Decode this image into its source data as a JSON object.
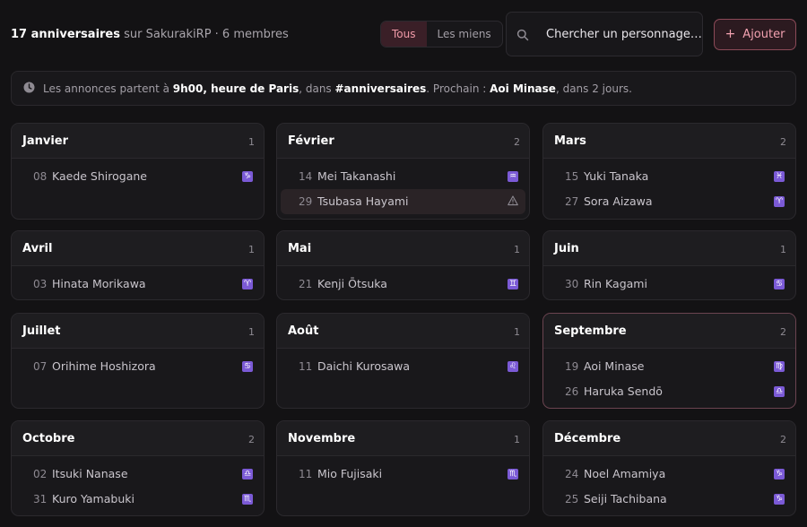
{
  "header": {
    "count": "17 anniversaires",
    "rest": " sur SakurakiRP · 6 membres"
  },
  "filters": {
    "all": "Tous",
    "mine": "Les miens",
    "active": "Tous"
  },
  "search": {
    "placeholder": "Chercher un personnage…"
  },
  "add_button": {
    "label": "Ajouter"
  },
  "notice": {
    "t1": "Les annonces partent à ",
    "b1": "9h00, heure de Paris",
    "t2": ", dans ",
    "b2": "#anniversaires",
    "t3": ". Prochain : ",
    "b3": "Aoi Minase",
    "t4": ", dans 2 jours."
  },
  "months": [
    {
      "name": "Janvier",
      "count": "1",
      "people": [
        {
          "day": "08",
          "name": "Kaede Shirogane",
          "sign": "♑"
        }
      ]
    },
    {
      "name": "Février",
      "count": "2",
      "people": [
        {
          "day": "14",
          "name": "Mei Takanashi",
          "sign": "♒"
        },
        {
          "day": "29",
          "name": "Tsubasa Hayami",
          "sign": "warning",
          "selected": true
        }
      ]
    },
    {
      "name": "Mars",
      "count": "2",
      "people": [
        {
          "day": "15",
          "name": "Yuki Tanaka",
          "sign": "♓"
        },
        {
          "day": "27",
          "name": "Sora Aizawa",
          "sign": "♈"
        }
      ]
    },
    {
      "name": "Avril",
      "count": "1",
      "people": [
        {
          "day": "03",
          "name": "Hinata Morikawa",
          "sign": "♈"
        }
      ]
    },
    {
      "name": "Mai",
      "count": "1",
      "people": [
        {
          "day": "21",
          "name": "Kenji Ōtsuka",
          "sign": "♊"
        }
      ]
    },
    {
      "name": "Juin",
      "count": "1",
      "people": [
        {
          "day": "30",
          "name": "Rin Kagami",
          "sign": "♋"
        }
      ]
    },
    {
      "name": "Juillet",
      "count": "1",
      "people": [
        {
          "day": "07",
          "name": "Orihime Hoshizora",
          "sign": "♋"
        }
      ]
    },
    {
      "name": "Août",
      "count": "1",
      "people": [
        {
          "day": "11",
          "name": "Daichi Kurosawa",
          "sign": "♌"
        }
      ]
    },
    {
      "name": "Septembre",
      "count": "2",
      "highlight": true,
      "people": [
        {
          "day": "19",
          "name": "Aoi Minase",
          "sign": "♍"
        },
        {
          "day": "26",
          "name": "Haruka Sendō",
          "sign": "♎"
        }
      ]
    },
    {
      "name": "Octobre",
      "count": "2",
      "people": [
        {
          "day": "02",
          "name": "Itsuki Nanase",
          "sign": "♎"
        },
        {
          "day": "31",
          "name": "Kuro Yamabuki",
          "sign": "♏"
        }
      ]
    },
    {
      "name": "Novembre",
      "count": "1",
      "people": [
        {
          "day": "11",
          "name": "Mio Fujisaki",
          "sign": "♏"
        }
      ]
    },
    {
      "name": "Décembre",
      "count": "2",
      "people": [
        {
          "day": "24",
          "name": "Noel Amamiya",
          "sign": "♑"
        },
        {
          "day": "25",
          "name": "Seiji Tachibana",
          "sign": "♑"
        }
      ]
    }
  ],
  "colors": {
    "accent": "#f19aa8",
    "zodiac": "#7b5ad6",
    "background": "#131214"
  }
}
